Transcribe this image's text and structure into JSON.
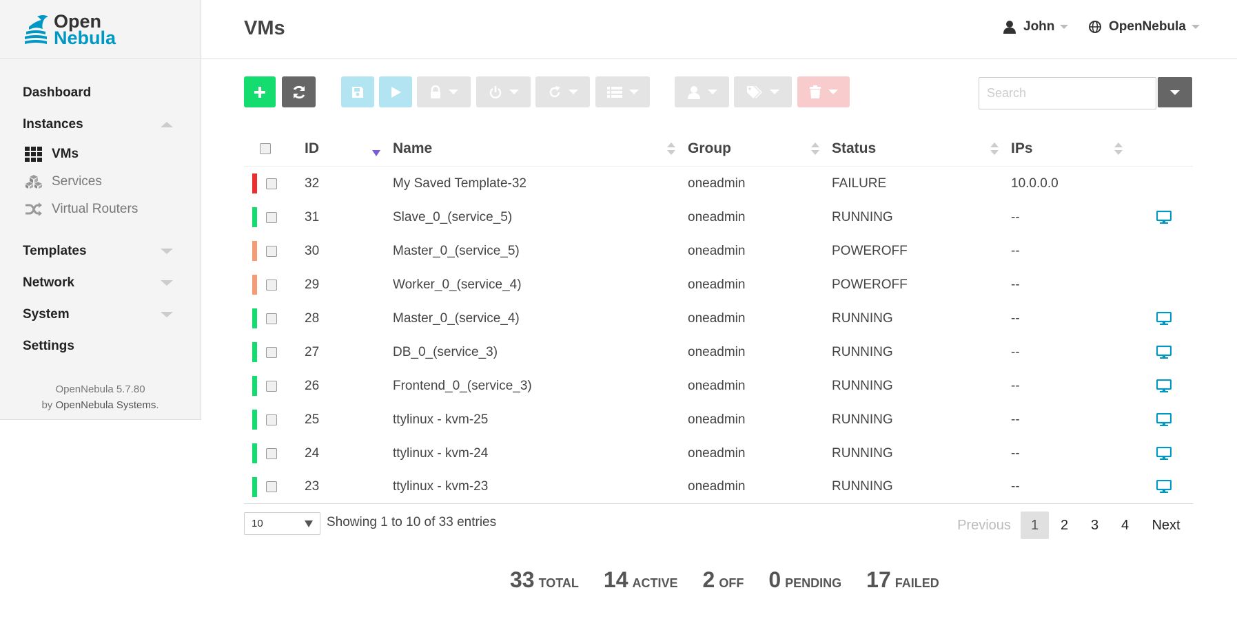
{
  "logo": {
    "line1": "Open",
    "line2": "Nebula"
  },
  "sidebar": {
    "dashboard": "Dashboard",
    "instances": "Instances",
    "sub": {
      "vms": "VMs",
      "services": "Services",
      "vrouters": "Virtual Routers"
    },
    "templates": "Templates",
    "network": "Network",
    "system": "System",
    "settings": "Settings",
    "version": "OpenNebula 5.7.80",
    "by": "by",
    "company": "OpenNebula Systems",
    "period": "."
  },
  "header": {
    "title": "VMs",
    "user": "John",
    "zone": "OpenNebula"
  },
  "search": {
    "placeholder": "Search"
  },
  "table": {
    "headers": {
      "id": "ID",
      "name": "Name",
      "group": "Group",
      "status": "Status",
      "ips": "IPs"
    },
    "rows": [
      {
        "id": "32",
        "name": "My Saved Template-32",
        "group": "oneadmin",
        "status": "FAILURE",
        "ips": "10.0.0.0",
        "state_color": "#ec2e2e",
        "vnc": false
      },
      {
        "id": "31",
        "name": "Slave_0_(service_5)",
        "group": "oneadmin",
        "status": "RUNNING",
        "ips": "--",
        "state_color": "#14dc6e",
        "vnc": true
      },
      {
        "id": "30",
        "name": "Master_0_(service_5)",
        "group": "oneadmin",
        "status": "POWEROFF",
        "ips": "--",
        "state_color": "#f49c76",
        "vnc": false
      },
      {
        "id": "29",
        "name": "Worker_0_(service_4)",
        "group": "oneadmin",
        "status": "POWEROFF",
        "ips": "--",
        "state_color": "#f49c76",
        "vnc": false
      },
      {
        "id": "28",
        "name": "Master_0_(service_4)",
        "group": "oneadmin",
        "status": "RUNNING",
        "ips": "--",
        "state_color": "#14dc6e",
        "vnc": true
      },
      {
        "id": "27",
        "name": "DB_0_(service_3)",
        "group": "oneadmin",
        "status": "RUNNING",
        "ips": "--",
        "state_color": "#14dc6e",
        "vnc": true
      },
      {
        "id": "26",
        "name": "Frontend_0_(service_3)",
        "group": "oneadmin",
        "status": "RUNNING",
        "ips": "--",
        "state_color": "#14dc6e",
        "vnc": true
      },
      {
        "id": "25",
        "name": "ttylinux - kvm-25",
        "group": "oneadmin",
        "status": "RUNNING",
        "ips": "--",
        "state_color": "#14dc6e",
        "vnc": true
      },
      {
        "id": "24",
        "name": "ttylinux - kvm-24",
        "group": "oneadmin",
        "status": "RUNNING",
        "ips": "--",
        "state_color": "#14dc6e",
        "vnc": true
      },
      {
        "id": "23",
        "name": "ttylinux - kvm-23",
        "group": "oneadmin",
        "status": "RUNNING",
        "ips": "--",
        "state_color": "#14dc6e",
        "vnc": true
      }
    ]
  },
  "footer": {
    "page_length": "10",
    "info": "Showing 1 to 10 of 33 entries",
    "previous": "Previous",
    "pages": [
      "1",
      "2",
      "3",
      "4"
    ],
    "next": "Next"
  },
  "stats": {
    "total_num": "33",
    "total_lbl": "TOTAL",
    "active_num": "14",
    "active_lbl": "ACTIVE",
    "off_num": "2",
    "off_lbl": "OFF",
    "pending_num": "0",
    "pending_lbl": "PENDING",
    "failed_num": "17",
    "failed_lbl": "FAILED"
  },
  "colors": {
    "brand": "#0098c3",
    "create": "#14dc6e",
    "vnc_icon": "#0098c3"
  }
}
